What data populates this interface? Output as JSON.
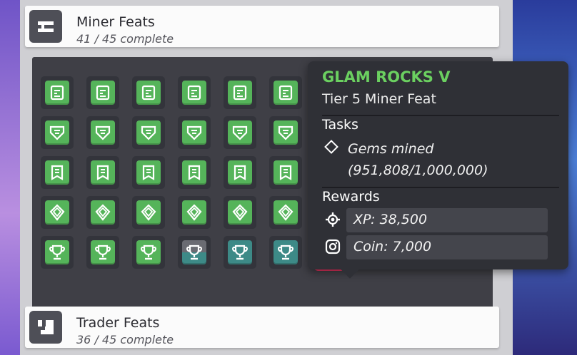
{
  "headers": [
    {
      "title": "Miner Feats",
      "progress": "41 / 45 complete"
    },
    {
      "title": "Trader Feats",
      "progress": "36 / 45 complete"
    }
  ],
  "grid": {
    "rows": [
      {
        "icon": "scroll-icon",
        "states": [
          "green",
          "green",
          "green",
          "green",
          "green",
          "green",
          "hidden",
          "hidden",
          "hidden"
        ]
      },
      {
        "icon": "shield-icon",
        "states": [
          "green",
          "green",
          "green",
          "green",
          "green",
          "green",
          "hidden",
          "hidden",
          "hidden"
        ]
      },
      {
        "icon": "banner-icon",
        "states": [
          "green",
          "green",
          "green",
          "green",
          "green",
          "green",
          "hidden",
          "hidden",
          "hidden"
        ]
      },
      {
        "icon": "gem-icon",
        "states": [
          "green",
          "green",
          "green",
          "green",
          "green",
          "green",
          "hidden",
          "hidden",
          "hidden"
        ]
      },
      {
        "icon": "trophy-icon",
        "states": [
          "green",
          "green",
          "green",
          "grey",
          "teal",
          "teal",
          "selected",
          "green",
          "green"
        ]
      }
    ]
  },
  "tooltip": {
    "title": "GLAM ROCKS V",
    "subtitle": "Tier 5 Miner Feat",
    "tasks_heading": "Tasks",
    "task": "Gems mined (951,808/1,000,000)",
    "rewards_heading": "Rewards",
    "rewards": [
      {
        "icon": "gear-icon",
        "label": "XP: 38,500"
      },
      {
        "icon": "coin-icon",
        "label": "Coin: 7,000"
      }
    ]
  },
  "colors": {
    "complete": "#55b45a",
    "partial": "#3d8a87",
    "title_green": "#6bd060",
    "selected": "#e3345e"
  }
}
